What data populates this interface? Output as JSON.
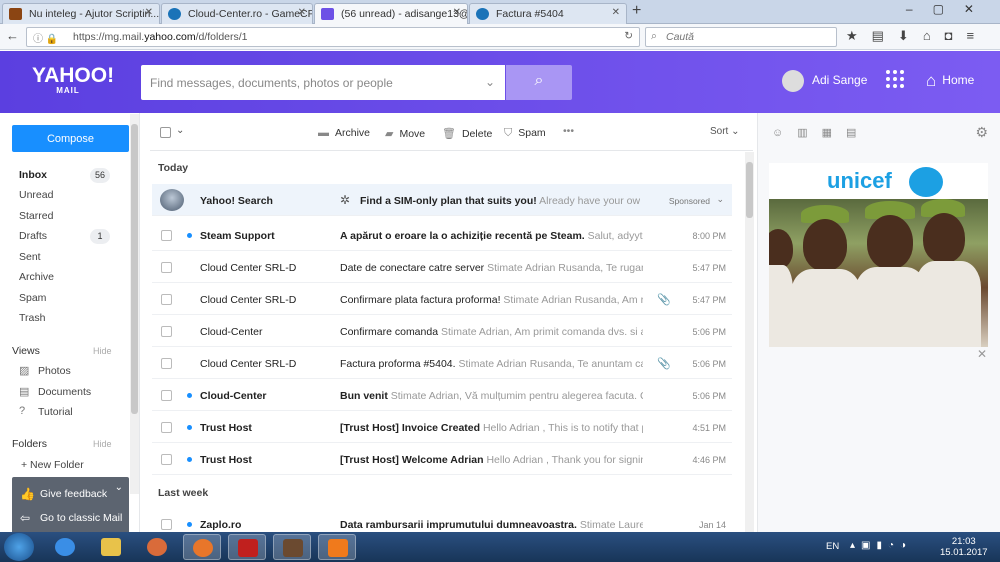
{
  "browser": {
    "tabs": [
      {
        "label": "Nu inteleg - Ajutor Scriptin...",
        "color": "#8b4513"
      },
      {
        "label": "Cloud-Center.ro - GameCP",
        "color": "#1a73b8"
      },
      {
        "label": "(56 unread) - adisange13@...",
        "color": "#6d51e6"
      },
      {
        "label": "Factura #5404",
        "color": "#1a73b8"
      }
    ],
    "url_prefix": "https://mg.mail.",
    "url_domain": "yahoo.com",
    "url_suffix": "/d/folders/1",
    "search_placeholder": "Caută"
  },
  "header": {
    "logo": "YAHOO!",
    "logo_sub": "MAIL",
    "search_placeholder": "Find messages, documents, photos or people",
    "user_name": "Adi Sange",
    "home_label": "Home"
  },
  "sidebar": {
    "compose": "Compose",
    "folders": [
      {
        "label": "Inbox",
        "badge": "56",
        "bold": true
      },
      {
        "label": "Unread",
        "badge": ""
      },
      {
        "label": "Starred",
        "badge": ""
      },
      {
        "label": "Drafts",
        "badge": "1"
      },
      {
        "label": "Sent",
        "badge": ""
      },
      {
        "label": "Archive",
        "badge": ""
      },
      {
        "label": "Spam",
        "badge": ""
      },
      {
        "label": "Trash",
        "badge": ""
      }
    ],
    "views_label": "Views",
    "hide_label": "Hide",
    "views": [
      {
        "label": "Photos",
        "icon": "photo-icon"
      },
      {
        "label": "Documents",
        "icon": "document-icon"
      },
      {
        "label": "Tutorial",
        "icon": "help-icon"
      }
    ],
    "folders_label": "Folders",
    "new_folder": "+ New Folder",
    "give_feedback": "Give feedback",
    "classic_mail": "Go to classic Mail"
  },
  "toolbar": {
    "archive": "Archive",
    "move": "Move",
    "delete": "Delete",
    "spam": "Spam",
    "more": "•••",
    "sort": "Sort"
  },
  "list": {
    "today_label": "Today",
    "lastweek_label": "Last week",
    "ad": {
      "sender": "Yahoo! Search",
      "subject": "Find a SIM-only plan that suits you!",
      "preview": "Already have your own p...",
      "sponsored": "Sponsored"
    },
    "messages": [
      {
        "sender": "Steam Support",
        "unread": true,
        "subject": "A apărut o eroare la o achiziție recentă pe Steam.",
        "preview": "Salut, adyytza130",
        "time": "8:00 PM",
        "attach": false
      },
      {
        "sender": "Cloud Center SRL-D",
        "unread": false,
        "subject": "Date de conectare catre server",
        "preview": "Stimate Adrian Rusanda, Te rugam sa",
        "time": "5:47 PM",
        "attach": false
      },
      {
        "sender": "Cloud Center SRL-D",
        "unread": false,
        "subject": "Confirmare plata factura proforma!",
        "preview": "Stimate Adrian Rusanda, Am recep",
        "time": "5:47 PM",
        "attach": true
      },
      {
        "sender": "Cloud-Center",
        "unread": false,
        "subject": "Confirmare comanda",
        "preview": "Stimate Adrian, Am primit comanda dvs. si aceas",
        "time": "5:06 PM",
        "attach": false
      },
      {
        "sender": "Cloud Center SRL-D",
        "unread": false,
        "subject": "Factura proforma #5404.",
        "preview": "Stimate Adrian Rusanda, Te anuntam ca fact",
        "time": "5:06 PM",
        "attach": true
      },
      {
        "sender": "Cloud-Center",
        "unread": true,
        "subject": "Bun venit",
        "preview": "Stimate Adrian, Vă mulțumim pentru alegerea facuta. Contu",
        "time": "5:06 PM",
        "attach": false
      },
      {
        "sender": "Trust Host",
        "unread": true,
        "subject": "[Trust Host] Invoice Created",
        "preview": "Hello Adrian , This is to notify that profo",
        "time": "4:51 PM",
        "attach": false
      },
      {
        "sender": "Trust Host",
        "unread": true,
        "subject": "[Trust Host] Welcome Adrian",
        "preview": "Hello Adrian , Thank you for signing up",
        "time": "4:46 PM",
        "attach": false
      }
    ],
    "lastweek": [
      {
        "sender": "Zaplo.ro",
        "unread": true,
        "subject": "Data rambursarii imprumutului dumneavoastra.",
        "preview": "Stimate Laureta Ev",
        "time": "Jan 14",
        "attach": false
      }
    ]
  },
  "rightpane": {
    "ad_brand": "unicef"
  },
  "taskbar": {
    "lang": "EN",
    "time": "21:03",
    "date": "15.01.2017"
  },
  "colors": {
    "brand": "#6d51e6",
    "compose": "#188fff",
    "unread_dot": "#188fff"
  }
}
